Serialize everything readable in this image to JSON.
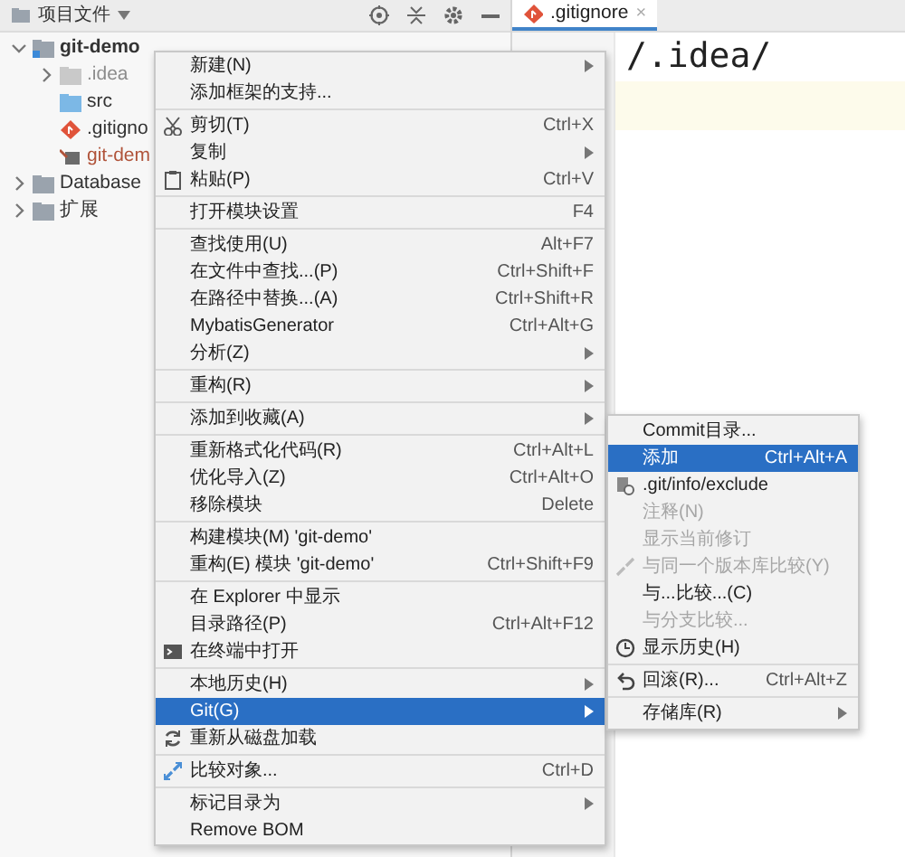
{
  "project_panel": {
    "title": "项目文件",
    "tree": [
      {
        "label": "git-demo",
        "kind": "module",
        "expanded": true,
        "color": "#333333",
        "children": [
          {
            "label": ".idea",
            "kind": "excluded-folder",
            "expanded": false,
            "color": "#8c8c8c"
          },
          {
            "label": "src",
            "kind": "folder",
            "color": "#333333"
          },
          {
            "label": ".gitigno",
            "kind": "git-file",
            "color": "#333333"
          },
          {
            "label": "git-dem",
            "kind": "module-file",
            "color": "#b0533a"
          }
        ]
      },
      {
        "label": "Database",
        "kind": "folder",
        "expanded": false,
        "color": "#333333"
      },
      {
        "label": "扩展",
        "kind": "folder",
        "expanded": false,
        "color": "#333333"
      }
    ]
  },
  "editor": {
    "tabs": [
      {
        "label": ".gitignore",
        "close": "×",
        "selected": true
      }
    ],
    "lines": [
      "/.idea/"
    ]
  },
  "context_menu": {
    "items": [
      {
        "kind": "item",
        "label": "新建(N)",
        "submenu": true,
        "selected": false
      },
      {
        "kind": "item",
        "label": "添加框架的支持...",
        "selected": false
      },
      {
        "kind": "separator"
      },
      {
        "kind": "item",
        "label": "剪切(T)",
        "shortcut": "Ctrl+X",
        "selected": false
      },
      {
        "kind": "item",
        "label": "复制",
        "submenu": true,
        "selected": false
      },
      {
        "kind": "item",
        "label": "粘贴(P)",
        "shortcut": "Ctrl+V",
        "selected": false
      },
      {
        "kind": "separator"
      },
      {
        "kind": "item",
        "label": "打开模块设置",
        "shortcut": "F4",
        "selected": false
      },
      {
        "kind": "separator"
      },
      {
        "kind": "item",
        "label": "查找使用(U)",
        "shortcut": "Alt+F7",
        "selected": false
      },
      {
        "kind": "item",
        "label": "在文件中查找...(P)",
        "shortcut": "Ctrl+Shift+F",
        "selected": false
      },
      {
        "kind": "item",
        "label": "在路径中替换...(A)",
        "shortcut": "Ctrl+Shift+R",
        "selected": false
      },
      {
        "kind": "item",
        "label": "MybatisGenerator",
        "shortcut": "Ctrl+Alt+G",
        "selected": false
      },
      {
        "kind": "item",
        "label": "分析(Z)",
        "submenu": true,
        "selected": false
      },
      {
        "kind": "separator"
      },
      {
        "kind": "item",
        "label": "重构(R)",
        "submenu": true,
        "selected": false
      },
      {
        "kind": "separator"
      },
      {
        "kind": "item",
        "label": "添加到收藏(A)",
        "submenu": true,
        "selected": false
      },
      {
        "kind": "separator"
      },
      {
        "kind": "item",
        "label": "重新格式化代码(R)",
        "shortcut": "Ctrl+Alt+L",
        "selected": false
      },
      {
        "kind": "item",
        "label": "优化导入(Z)",
        "shortcut": "Ctrl+Alt+O",
        "selected": false
      },
      {
        "kind": "item",
        "label": "移除模块",
        "shortcut": "Delete",
        "selected": false
      },
      {
        "kind": "separator"
      },
      {
        "kind": "item",
        "label": "构建模块(M) 'git-demo'",
        "selected": false
      },
      {
        "kind": "item",
        "label": "重构(E) 模块 'git-demo'",
        "shortcut": "Ctrl+Shift+F9",
        "selected": false
      },
      {
        "kind": "separator"
      },
      {
        "kind": "item",
        "label": "在 Explorer 中显示",
        "selected": false
      },
      {
        "kind": "item",
        "label": "目录路径(P)",
        "shortcut": "Ctrl+Alt+F12",
        "selected": false
      },
      {
        "kind": "item",
        "label": "在终端中打开",
        "selected": false
      },
      {
        "kind": "separator"
      },
      {
        "kind": "item",
        "label": "本地历史(H)",
        "submenu": true,
        "selected": false
      },
      {
        "kind": "item",
        "label": "Git(G)",
        "submenu": true,
        "selected": true
      },
      {
        "kind": "item",
        "label": "重新从磁盘加载",
        "selected": false
      },
      {
        "kind": "separator"
      },
      {
        "kind": "item",
        "label": "比较对象...",
        "shortcut": "Ctrl+D",
        "selected": false
      },
      {
        "kind": "separator"
      },
      {
        "kind": "item",
        "label": "标记目录为",
        "submenu": true,
        "selected": false
      },
      {
        "kind": "item",
        "label": "Remove BOM",
        "selected": false
      }
    ]
  },
  "git_submenu": {
    "items": [
      {
        "kind": "item",
        "label": "Commit目录...",
        "selected": false,
        "disabled": false
      },
      {
        "kind": "item",
        "label": "添加",
        "shortcut": "Ctrl+Alt+A",
        "selected": true,
        "disabled": false
      },
      {
        "kind": "item",
        "label": ".git/info/exclude",
        "selected": false,
        "disabled": false
      },
      {
        "kind": "item",
        "label": "注释(N)",
        "selected": false,
        "disabled": true
      },
      {
        "kind": "item",
        "label": "显示当前修订",
        "selected": false,
        "disabled": true
      },
      {
        "kind": "item",
        "label": "与同一个版本库比较(Y)",
        "selected": false,
        "disabled": true
      },
      {
        "kind": "item",
        "label": "与...比较...(C)",
        "selected": false,
        "disabled": false
      },
      {
        "kind": "item",
        "label": "与分支比较...",
        "selected": false,
        "disabled": true
      },
      {
        "kind": "item",
        "label": "显示历史(H)",
        "selected": false,
        "disabled": false
      },
      {
        "kind": "separator"
      },
      {
        "kind": "item",
        "label": "回滚(R)...",
        "shortcut": "Ctrl+Alt+Z",
        "selected": false,
        "disabled": false
      },
      {
        "kind": "separator"
      },
      {
        "kind": "item",
        "label": "存储库(R)",
        "submenu": true,
        "selected": false,
        "disabled": false
      }
    ]
  }
}
